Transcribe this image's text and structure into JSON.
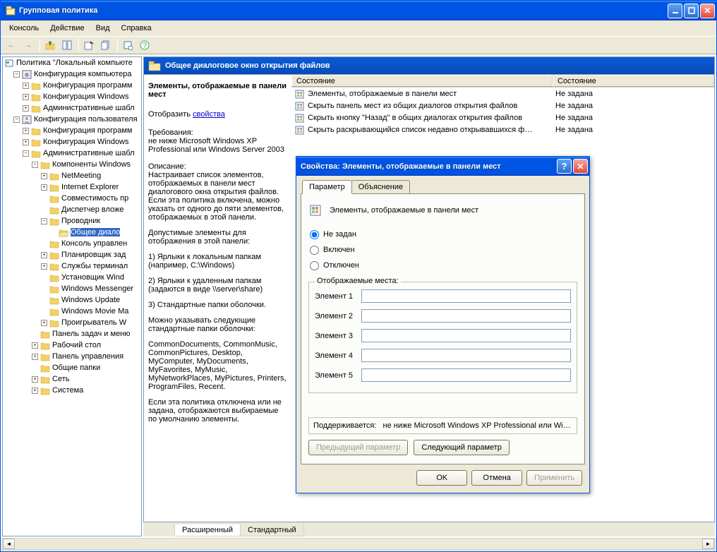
{
  "window": {
    "title": "Групповая политика"
  },
  "menu": {
    "items": [
      "Консоль",
      "Действие",
      "Вид",
      "Справка"
    ]
  },
  "tree": {
    "root": "Политика \"Локальный компьюте",
    "nodes": [
      {
        "d": 1,
        "e": "-",
        "t": "Конфигурация компьютера",
        "ic": "gear"
      },
      {
        "d": 2,
        "e": "+",
        "t": "Конфигурация программ"
      },
      {
        "d": 2,
        "e": "+",
        "t": "Конфигурация Windows"
      },
      {
        "d": 2,
        "e": "+",
        "t": "Административные шабл"
      },
      {
        "d": 1,
        "e": "-",
        "t": "Конфигурация пользователя",
        "ic": "user"
      },
      {
        "d": 2,
        "e": "+",
        "t": "Конфигурация программ"
      },
      {
        "d": 2,
        "e": "+",
        "t": "Конфигурация Windows"
      },
      {
        "d": 2,
        "e": "-",
        "t": "Административные шабл"
      },
      {
        "d": 3,
        "e": "-",
        "t": "Компоненты Windows"
      },
      {
        "d": 4,
        "e": "+",
        "t": "NetMeeting"
      },
      {
        "d": 4,
        "e": "+",
        "t": "Internet Explorer"
      },
      {
        "d": 4,
        "e": " ",
        "t": "Совместимость пр"
      },
      {
        "d": 4,
        "e": " ",
        "t": "Диспетчер вложе"
      },
      {
        "d": 4,
        "e": "-",
        "t": "Проводник"
      },
      {
        "d": 5,
        "e": " ",
        "t": "Общее диало",
        "sel": true,
        "open": true
      },
      {
        "d": 4,
        "e": " ",
        "t": "Консоль управлен"
      },
      {
        "d": 4,
        "e": "+",
        "t": "Планировщик зад"
      },
      {
        "d": 4,
        "e": "+",
        "t": "Службы терминал"
      },
      {
        "d": 4,
        "e": " ",
        "t": "Установщик Wind"
      },
      {
        "d": 4,
        "e": " ",
        "t": "Windows Messenger"
      },
      {
        "d": 4,
        "e": " ",
        "t": "Windows Update"
      },
      {
        "d": 4,
        "e": " ",
        "t": "Windows Movie Ma"
      },
      {
        "d": 4,
        "e": "+",
        "t": "Проигрыватель W"
      },
      {
        "d": 3,
        "e": " ",
        "t": "Панель задач и меню"
      },
      {
        "d": 3,
        "e": "+",
        "t": "Рабочий стол"
      },
      {
        "d": 3,
        "e": "+",
        "t": "Панель управления"
      },
      {
        "d": 3,
        "e": " ",
        "t": "Общие папки"
      },
      {
        "d": 3,
        "e": "+",
        "t": "Сеть"
      },
      {
        "d": 3,
        "e": "+",
        "t": "Система"
      }
    ]
  },
  "header": {
    "title": "Общее диалоговое окно открытия файлов"
  },
  "desc": {
    "bold1": "Элементы, отображаемые в панели мест",
    "showlbl": "Отобразить",
    "showlnk": "свойства",
    "reqhdr": "Требования:",
    "reqtxt": "не ниже Microsoft Windows XP Professional или Windows Server 2003",
    "dschdr": "Описание:",
    "dsctxt": "Настраивает список элементов, отображаемых в панели мест диалогового окна открытия файлов. Если эта политика включена, можно указать от одного до пяти элементов, отображаемых в этой панели.",
    "extra1": "Допустимые элементы для отображения в этой панели:",
    "li1": "1) Ярлыки к локальным папкам (например, C:\\Windows)",
    "li2": "2) Ярлыки к удаленным папкам (задаются в виде \\\\server\\share)",
    "li3": "3) Стандартные папки оболочки.",
    "extra2": "Можно указывать следующие стандартные папки оболочки:",
    "folders": "CommonDocuments, CommonMusic, CommonPictures, Desktop, MyComputer, MyDocuments, MyFavorites, MyMusic, MyNetworkPlaces, MyPictures, Printers, ProgramFiles, Recent.",
    "extra3": "Если эта политика отключена или не задана, отображаются выбираемые по умолчанию элементы."
  },
  "list": {
    "cols": [
      "Состояние",
      "Состояние"
    ],
    "rows": [
      {
        "t": "Элементы, отображаемые в панели мест",
        "s": "Не задана"
      },
      {
        "t": "Скрыть панель мест из общих диалогов открытия файлов",
        "s": "Не задана"
      },
      {
        "t": "Скрыть кнопку \"Назад\" в общих диалогах открытия файлов",
        "s": "Не задана"
      },
      {
        "t": "Скрыть раскрывающийся список недавно открывавшихся ф…",
        "s": "Не задана"
      }
    ]
  },
  "tabs": {
    "items": [
      "Расширенный",
      "Стандартный"
    ],
    "active": 0
  },
  "dialog": {
    "title": "Свойства: Элементы, отображаемые в панели мест",
    "tabs": [
      "Параметр",
      "Объяснение"
    ],
    "heading": "Элементы, отображаемые в панели мест",
    "radios": [
      "Не задан",
      "Включен",
      "Отключен"
    ],
    "fieldset_legend": "Отображаемые места:",
    "elems": [
      "Элемент 1",
      "Элемент 2",
      "Элемент 3",
      "Элемент 4",
      "Элемент 5"
    ],
    "support_label": "Поддерживается:",
    "support_text": "не ниже Microsoft Windows XP Professional или Wi…",
    "prev": "Предыдущий параметр",
    "next": "Следующий параметр",
    "ok": "OK",
    "cancel": "Отмена",
    "apply": "Применить"
  }
}
